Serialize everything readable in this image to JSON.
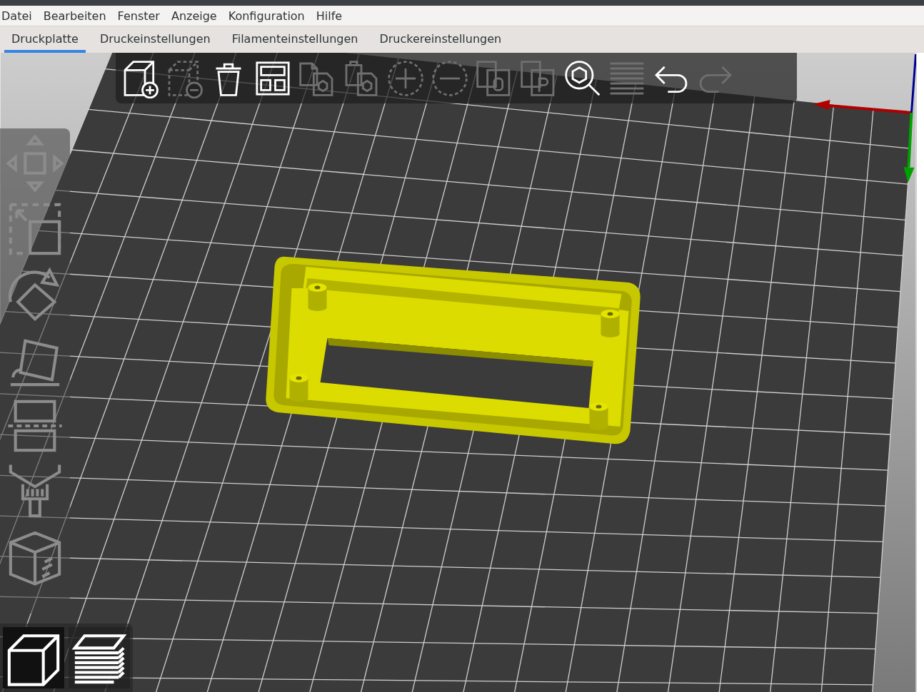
{
  "menu": [
    "Datei",
    "Bearbeiten",
    "Fenster",
    "Anzeige",
    "Konfiguration",
    "Hilfe"
  ],
  "tabs": [
    {
      "label": "Druckplatte",
      "selected": true
    },
    {
      "label": "Druckeinstellungen",
      "selected": false
    },
    {
      "label": "Filamenteinstellungen",
      "selected": false
    },
    {
      "label": "Druckereinstellungen",
      "selected": false
    }
  ],
  "top_toolbar": [
    {
      "kind": "add",
      "disabled": false
    },
    {
      "kind": "delete",
      "disabled": true
    },
    {
      "kind": "clear",
      "disabled": false
    },
    {
      "kind": "arrange",
      "disabled": false
    },
    {
      "kind": "copy",
      "disabled": true
    },
    {
      "kind": "paste",
      "disabled": true
    },
    {
      "kind": "plus",
      "disabled": true
    },
    {
      "kind": "minus",
      "disabled": true
    },
    {
      "kind": "split",
      "disabled": true
    },
    {
      "kind": "parts",
      "disabled": true
    },
    {
      "kind": "search",
      "disabled": false
    },
    {
      "kind": "layers",
      "disabled": true
    },
    {
      "kind": "undo",
      "disabled": false
    },
    {
      "kind": "redo",
      "disabled": true
    }
  ],
  "left_toolbar": [
    {
      "kind": "move",
      "disabled": true
    },
    {
      "kind": "scale",
      "disabled": true
    },
    {
      "kind": "rotate",
      "disabled": true
    },
    {
      "kind": "place",
      "disabled": true
    },
    {
      "kind": "cut",
      "disabled": true
    },
    {
      "kind": "paint",
      "disabled": true
    },
    {
      "kind": "seam",
      "disabled": true
    }
  ],
  "view_toggle": [
    {
      "kind": "cube",
      "selected": true
    },
    {
      "kind": "preview",
      "selected": false
    }
  ]
}
